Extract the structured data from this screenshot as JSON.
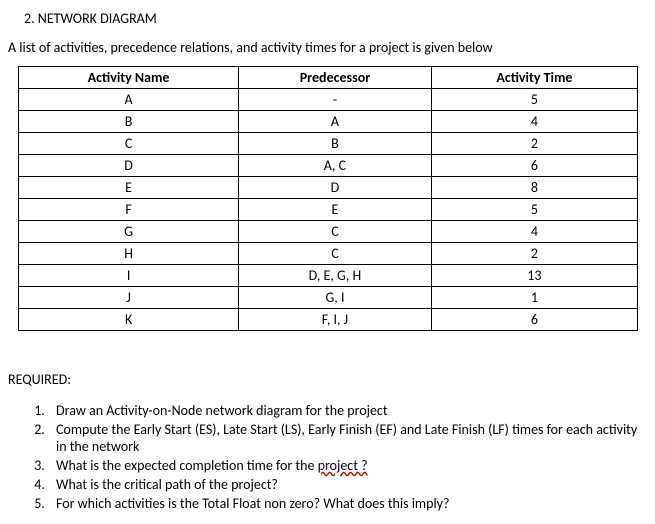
{
  "heading": "2.   NETWORK DIAGRAM",
  "intro": "A list of activities, precedence relations, and activity times for a project is given below",
  "table": {
    "headers": [
      "Activity Name",
      "Predecessor",
      "Activity Time"
    ],
    "rows": [
      [
        "A",
        "-",
        "5"
      ],
      [
        "B",
        "A",
        "4"
      ],
      [
        "C",
        "B",
        "2"
      ],
      [
        "D",
        "A, C",
        "6"
      ],
      [
        "E",
        "D",
        "8"
      ],
      [
        "F",
        "E",
        "5"
      ],
      [
        "G",
        "C",
        "4"
      ],
      [
        "H",
        "C",
        "2"
      ],
      [
        "I",
        "D, E, G, H",
        "13"
      ],
      [
        "J",
        "G, I",
        "1"
      ],
      [
        "K",
        "F, I, J",
        "6"
      ]
    ]
  },
  "required_label": "REQUIRED:",
  "questions": [
    "Draw an Activity-on-Node network diagram for the project",
    "Compute the Early Start (ES), Late Start (LS), Early Finish (EF) and Late Finish (LF) times for each activity in the network",
    "What is the expected completion time for the ",
    "What is the critical path of the project?",
    "For which activities is the Total Float non zero? What does this imply?"
  ],
  "q3_wavy": "project ?"
}
